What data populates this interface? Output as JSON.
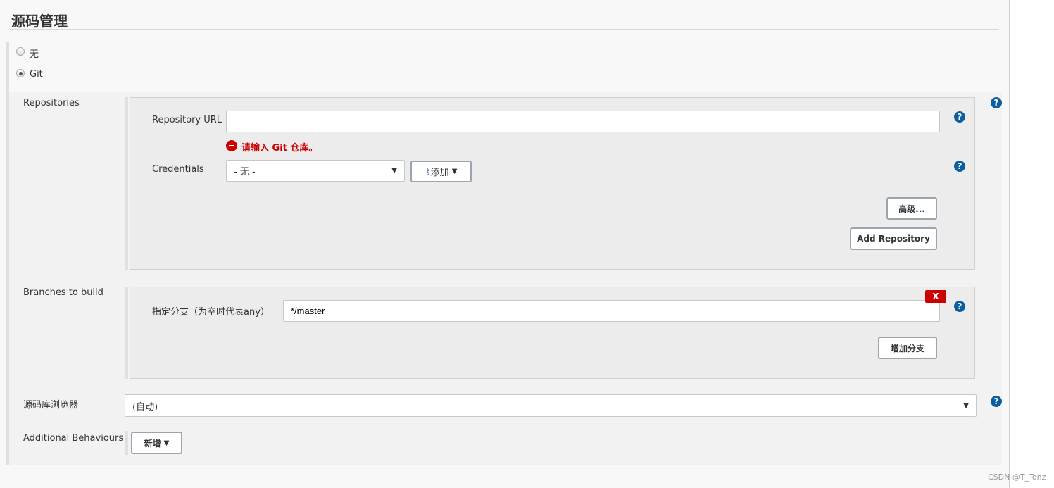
{
  "section_title": "源码管理",
  "scm_options": [
    {
      "label": "无",
      "selected": false
    },
    {
      "label": "Git",
      "selected": true
    }
  ],
  "repositories": {
    "label": "Repositories",
    "url_label": "Repository URL",
    "url_value": "",
    "error": "请输入 Git 仓库。",
    "credentials_label": "Credentials",
    "credentials_value": "- 无 -",
    "add_label": "添加",
    "advanced_label": "高级...",
    "add_repo_label": "Add Repository"
  },
  "branches": {
    "label": "Branches to build",
    "spec_label": "指定分支（为空时代表any）",
    "spec_value": "*/master",
    "delete_label": "X",
    "add_branch_label": "增加分支"
  },
  "browser": {
    "label": "源码库浏览器",
    "value": "(自动)"
  },
  "behaviours": {
    "label": "Additional Behaviours",
    "add_label": "新增"
  },
  "help_glyph": "?",
  "watermark": "CSDN @T_Tonz",
  "colors": {
    "error": "#cc0000",
    "help": "#0b5fa0"
  }
}
